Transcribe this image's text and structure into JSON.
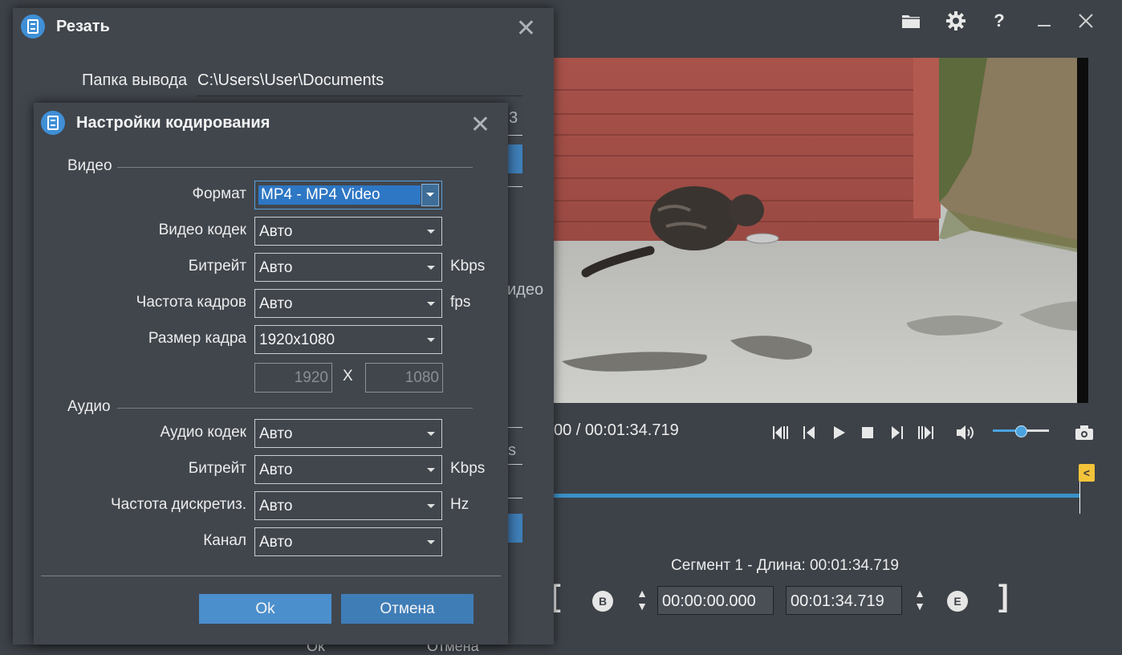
{
  "main": {
    "time_display": "00 / 00:01:34.719",
    "segment_text": "Сегмент 1 - Длина: 00:01:34.719",
    "start_time": "00:00:00.000",
    "end_time": "00:01:34.719",
    "begin_label": "B",
    "end_label": "E",
    "marker_label": "<",
    "volume_fraction": 0.5
  },
  "cut_dialog": {
    "title": "Резать",
    "output_folder_label": "Папка вывода",
    "output_folder_value": "C:\\Users\\User\\Documents",
    "peek_digit": "3",
    "peek_video": "идео",
    "peek_s": "s",
    "peek_ok": "Ok",
    "peek_cancel": "Отмена"
  },
  "encoding_dialog": {
    "title": "Настройки кодирования",
    "video_section": "Видео",
    "audio_section": "Аудио",
    "video_fields": [
      {
        "label": "Формат",
        "value": "MP4 - MP4 Video",
        "unit": ""
      },
      {
        "label": "Видео кодек",
        "value": "Авто",
        "unit": ""
      },
      {
        "label": "Битрейт",
        "value": "Авто",
        "unit": "Kbps"
      },
      {
        "label": "Частота кадров",
        "value": "Авто",
        "unit": "fps"
      },
      {
        "label": "Размер кадра",
        "value": "1920x1080",
        "unit": ""
      }
    ],
    "frame_width": "1920",
    "frame_height": "1080",
    "x_label": "X",
    "audio_fields": [
      {
        "label": "Аудио кодек",
        "value": "Авто",
        "unit": ""
      },
      {
        "label": "Битрейт",
        "value": "Авто",
        "unit": "Kbps"
      },
      {
        "label": "Частота дискретиз.",
        "value": "Авто",
        "unit": "Hz"
      },
      {
        "label": "Канал",
        "value": "Авто",
        "unit": ""
      }
    ],
    "ok_label": "Ok",
    "cancel_label": "Отмена"
  },
  "icons": [
    "folder-icon",
    "gear-icon",
    "help-icon",
    "minimize-icon",
    "close-icon",
    "film-app-icon",
    "camera-icon",
    "volume-icon"
  ],
  "colors": {
    "accent": "#3f8fd6",
    "marker": "#f3c33a",
    "background": "#3d4248"
  }
}
